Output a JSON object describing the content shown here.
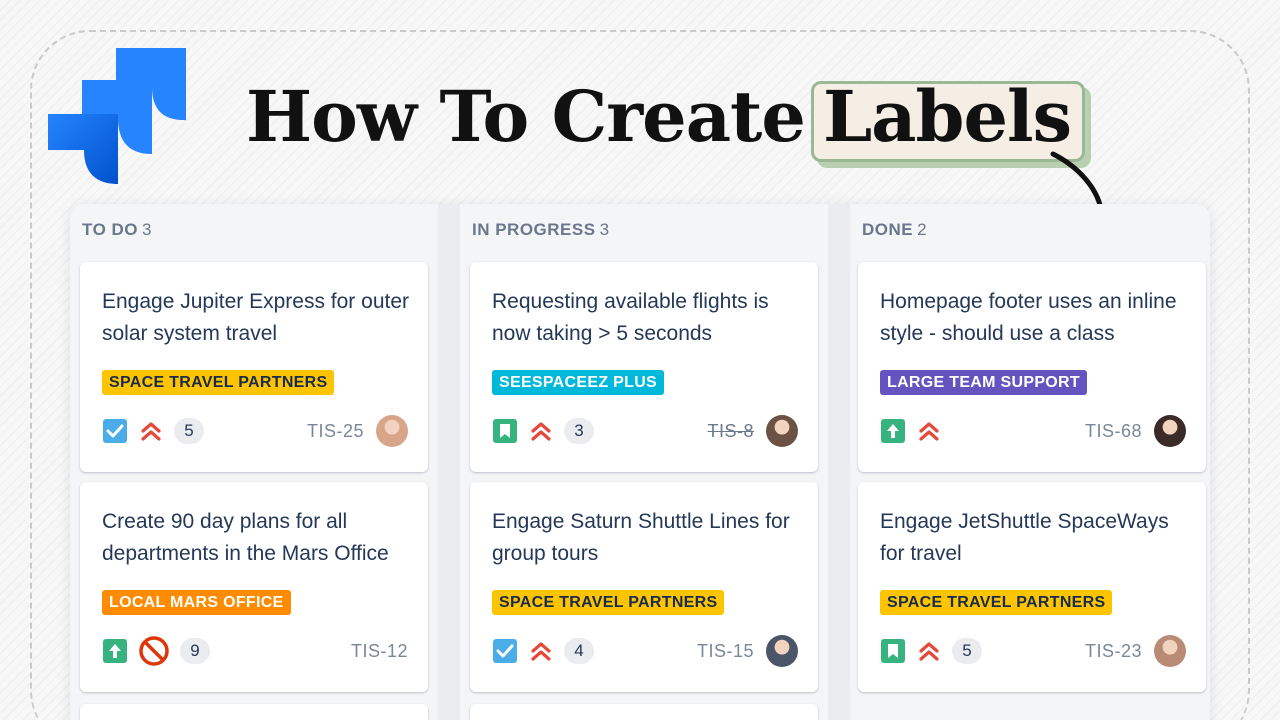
{
  "title": {
    "main": "How To Create",
    "highlight": "Labels"
  },
  "board": {
    "columns": [
      {
        "name": "TO DO",
        "count": "3",
        "cards": [
          {
            "title": "Engage Jupiter Express for outer solar system travel",
            "label": "SPACE TRAVEL PARTNERS",
            "label_bg": "#ffc400",
            "label_fg": "#172b4d",
            "type_icon": "checkbox-icon",
            "priority_icon": "priority-highest-icon",
            "points": "5",
            "key": "TIS-25",
            "avatar_color": "#d9a58a"
          },
          {
            "title": "Create 90 day plans for all departments in the Mars Office",
            "label": "LOCAL MARS OFFICE",
            "label_bg": "#ff8b00",
            "label_fg": "#ffffff",
            "type_icon": "story-arrow-icon",
            "priority_icon": "blocker-icon",
            "points": "9",
            "key": "TIS-12",
            "avatar_color": ""
          }
        ]
      },
      {
        "name": "IN PROGRESS",
        "count": "3",
        "cards": [
          {
            "title": "Requesting available flights is now taking > 5 seconds",
            "label": "SEESPACEEZ PLUS",
            "label_bg": "#00b8d9",
            "label_fg": "#ffffff",
            "type_icon": "bookmark-icon",
            "priority_icon": "priority-highest-icon",
            "points": "3",
            "key": "TIS-8",
            "avatar_color": "#6b5244"
          },
          {
            "title": "Engage Saturn Shuttle Lines for group tours",
            "label": "SPACE TRAVEL PARTNERS",
            "label_bg": "#ffc400",
            "label_fg": "#172b4d",
            "type_icon": "checkbox-icon",
            "priority_icon": "priority-highest-icon",
            "points": "4",
            "key": "TIS-15",
            "avatar_color": "#4a5568"
          }
        ]
      },
      {
        "name": "DONE",
        "count": "2",
        "cards": [
          {
            "title": "Homepage footer uses an inline style - should use a class",
            "label": "LARGE TEAM SUPPORT",
            "label_bg": "#6554c0",
            "label_fg": "#ffffff",
            "type_icon": "story-arrow-icon",
            "priority_icon": "priority-highest-icon",
            "points": "",
            "key": "TIS-68",
            "avatar_color": "#3b2a28"
          },
          {
            "title": "Engage JetShuttle SpaceWays for travel",
            "label": "SPACE TRAVEL PARTNERS",
            "label_bg": "#ffc400",
            "label_fg": "#172b4d",
            "type_icon": "bookmark-icon",
            "priority_icon": "priority-highest-icon",
            "points": "5",
            "key": "TIS-23",
            "avatar_color": "#b98a74"
          }
        ]
      }
    ]
  },
  "colors": {
    "brand_blue": "#2684ff",
    "column_bg": "#f4f5f7",
    "highlight_bg": "#f4eee5",
    "highlight_border": "#9bb894"
  }
}
